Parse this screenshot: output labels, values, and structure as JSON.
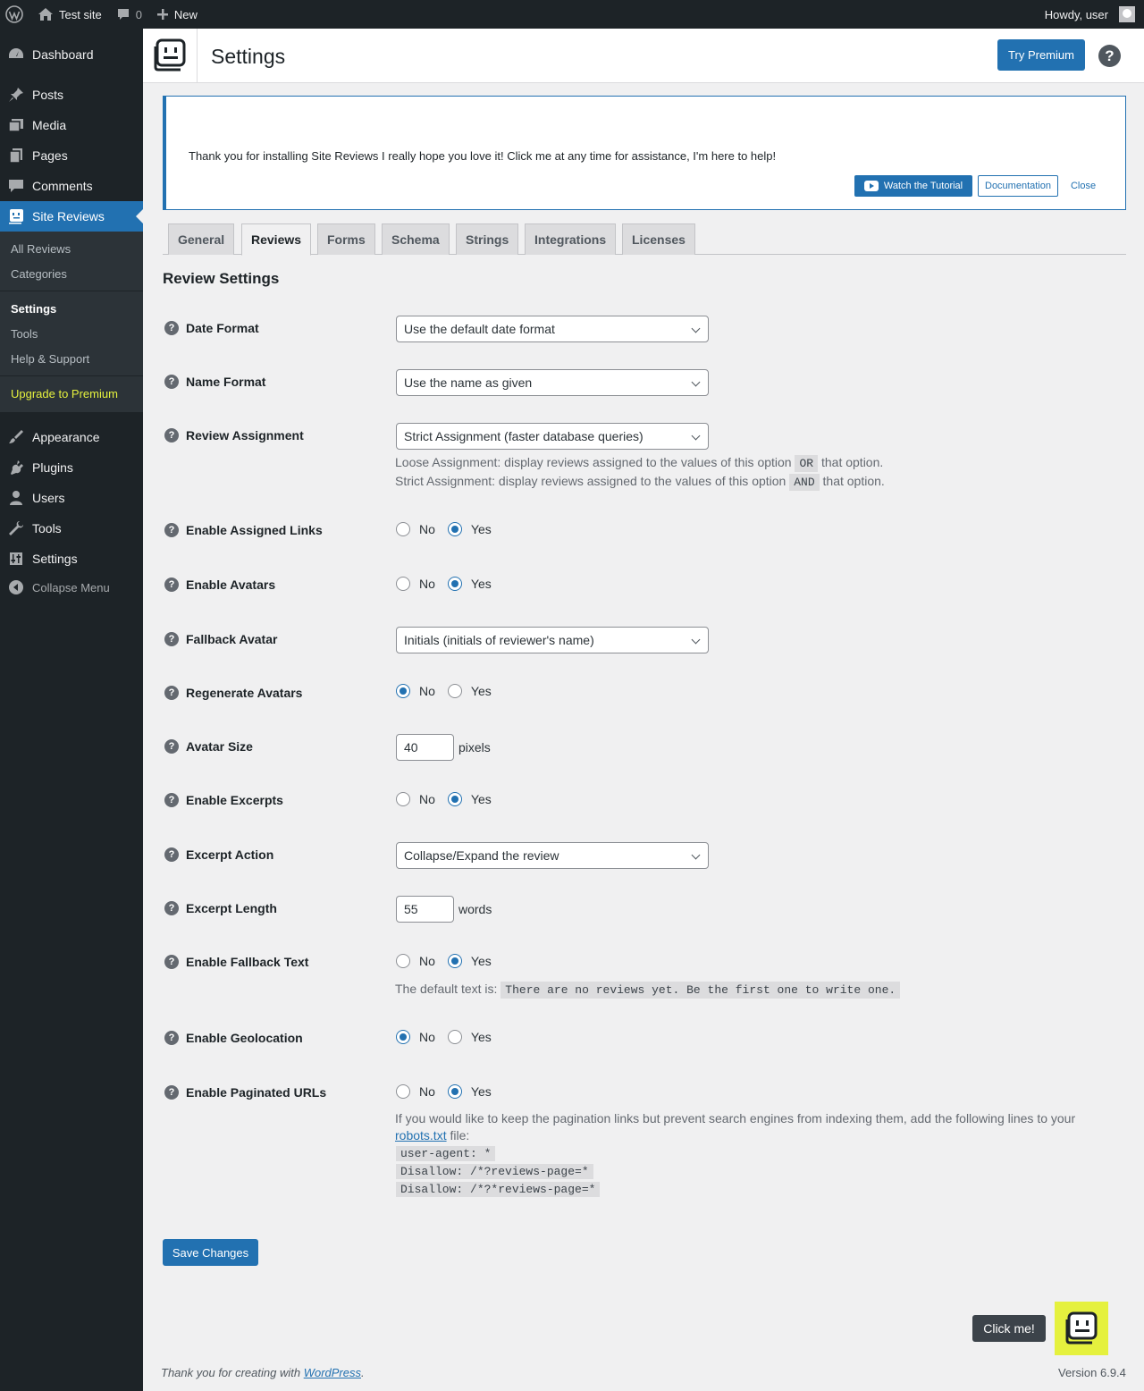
{
  "adminbar": {
    "site_name": "Test site",
    "comments_count": "0",
    "new_label": "New",
    "howdy": "Howdy, user"
  },
  "sidebar": {
    "items": [
      {
        "label": "Dashboard",
        "icon": "dashboard-icon"
      },
      {
        "label": "Posts",
        "icon": "pin-icon"
      },
      {
        "label": "Media",
        "icon": "media-icon"
      },
      {
        "label": "Pages",
        "icon": "pages-icon"
      },
      {
        "label": "Comments",
        "icon": "comment-icon"
      },
      {
        "label": "Site Reviews",
        "icon": "site-reviews-icon"
      },
      {
        "label": "Appearance",
        "icon": "brush-icon"
      },
      {
        "label": "Plugins",
        "icon": "plug-icon"
      },
      {
        "label": "Users",
        "icon": "user-icon"
      },
      {
        "label": "Tools",
        "icon": "wrench-icon"
      },
      {
        "label": "Settings",
        "icon": "sliders-icon"
      }
    ],
    "submenu": [
      "All Reviews",
      "Categories",
      "Settings",
      "Tools",
      "Help & Support",
      "Upgrade to Premium"
    ],
    "collapse_label": "Collapse Menu"
  },
  "header": {
    "title": "Settings",
    "premium_label": "Try Premium",
    "help_label": "?"
  },
  "notice": {
    "message": "Thank you for installing Site Reviews I really hope you love it! Click me at any time for assistance, I'm here to help!",
    "tutorial_label": "Watch the Tutorial",
    "documentation_label": "Documentation",
    "close_label": "Close"
  },
  "tabs": [
    "General",
    "Reviews",
    "Forms",
    "Schema",
    "Strings",
    "Integrations",
    "Licenses"
  ],
  "active_tab": "Reviews",
  "section_title": "Review Settings",
  "fields": {
    "date_format": {
      "label": "Date Format",
      "value": "Use the default date format"
    },
    "name_format": {
      "label": "Name Format",
      "value": "Use the name as given"
    },
    "review_assignment": {
      "label": "Review Assignment",
      "value": "Strict Assignment (faster database queries)",
      "desc_loose_a": "Loose Assignment: display reviews assigned to the values of this option",
      "desc_loose_code": "OR",
      "desc_loose_b": "that option.",
      "desc_strict_a": "Strict Assignment: display reviews assigned to the values of this option",
      "desc_strict_code": "AND",
      "desc_strict_b": "that option."
    },
    "assigned_links": {
      "label": "Enable Assigned Links",
      "selected": "Yes"
    },
    "avatars": {
      "label": "Enable Avatars",
      "selected": "Yes"
    },
    "fallback_avatar": {
      "label": "Fallback Avatar",
      "value": "Initials (initials of reviewer's name)"
    },
    "regenerate_avatars": {
      "label": "Regenerate Avatars",
      "selected": "No"
    },
    "avatar_size": {
      "label": "Avatar Size",
      "value": "40",
      "unit": "pixels"
    },
    "excerpts": {
      "label": "Enable Excerpts",
      "selected": "Yes"
    },
    "excerpt_action": {
      "label": "Excerpt Action",
      "value": "Collapse/Expand the review"
    },
    "excerpt_length": {
      "label": "Excerpt Length",
      "value": "55",
      "unit": "words"
    },
    "fallback_text": {
      "label": "Enable Fallback Text",
      "selected": "Yes",
      "desc": "The default text is:",
      "code": "There are no reviews yet. Be the first one to write one."
    },
    "geolocation": {
      "label": "Enable Geolocation",
      "selected": "No"
    },
    "paginated_urls": {
      "label": "Enable Paginated URLs",
      "selected": "Yes",
      "desc_a": "If you would like to keep the pagination links but prevent search engines from indexing them, add the following lines to your",
      "desc_link": "robots.txt",
      "desc_b": "file:",
      "code_lines": [
        "user-agent: *",
        "Disallow: /*?reviews-page=*",
        "Disallow: /*?*reviews-page=*"
      ]
    }
  },
  "radio_options": {
    "no": "No",
    "yes": "Yes"
  },
  "save_label": "Save Changes",
  "click_me_label": "Click me!",
  "footer": {
    "thanks_a": "Thank you for creating with",
    "thanks_link": "WordPress",
    "thanks_b": ".",
    "version": "Version 6.9.4"
  },
  "colors": {
    "accent": "#2271b1",
    "adminbar_bg": "#1d2327",
    "helper_bg": "#e5f13e"
  }
}
